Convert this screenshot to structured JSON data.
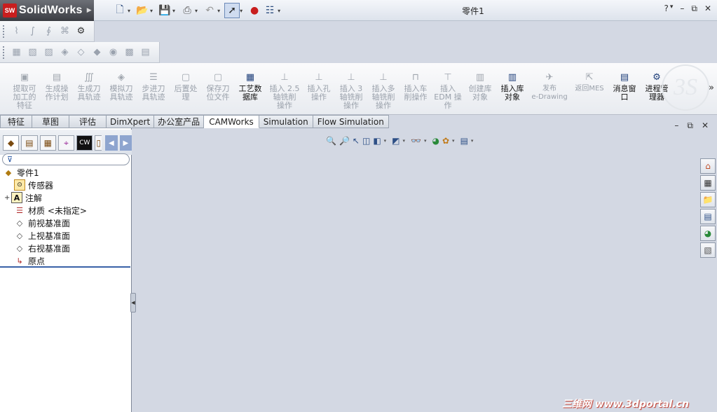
{
  "app": {
    "brand_badge": "SW",
    "name": "SolidWorks",
    "doc_title": "零件1"
  },
  "win_controls": {
    "help": "?",
    "help_dd": "▾",
    "minimize": "–",
    "restore": "⧉",
    "close": "✕"
  },
  "command_manager": [
    {
      "label": "提取可\n加工的\n特征",
      "active": false
    },
    {
      "label": "生成操\n作计划",
      "active": false
    },
    {
      "label": "生成刀\n具轨迹",
      "active": false
    },
    {
      "label": "模拟刀\n具轨迹",
      "active": false
    },
    {
      "label": "步进刀\n具轨迹",
      "active": false
    },
    {
      "label": "后置处\n理",
      "active": false
    },
    {
      "label": "保存刀\n位文件",
      "active": false
    },
    {
      "label": "工艺数\n据库",
      "active": true
    },
    {
      "label": "插入 2.5\n轴铣削\n操作",
      "active": false
    },
    {
      "label": "插入孔\n操作",
      "active": false
    },
    {
      "label": "插入 3\n轴铣削\n操作",
      "active": false
    },
    {
      "label": "插入多\n轴铣削\n操作",
      "active": false
    },
    {
      "label": "插入车\n削操作",
      "active": false
    },
    {
      "label": "插入\nEDM 操\n作",
      "active": false
    },
    {
      "label": "创建库\n对象",
      "active": false
    },
    {
      "label": "插入库\n对象",
      "active": true
    },
    {
      "label": "发布\ne-Drawing",
      "active": false
    },
    {
      "label": "返回MES",
      "active": false
    },
    {
      "label": "消息窗\n口",
      "active": true
    },
    {
      "label": "进程管\n理器",
      "active": true
    }
  ],
  "more_commands": "»",
  "tabs": [
    {
      "label": "特征",
      "active": false
    },
    {
      "label": "草图",
      "active": false
    },
    {
      "label": "评估",
      "active": false
    },
    {
      "label": "DimXpert",
      "active": false
    },
    {
      "label": "办公室产品",
      "active": false
    },
    {
      "label": "CAMWorks",
      "active": true
    },
    {
      "label": "Simulation",
      "active": false
    },
    {
      "label": "Flow Simulation",
      "active": false
    }
  ],
  "filter_icon": "⊽",
  "tree": [
    {
      "label": "零件1",
      "icon": "part-icon"
    },
    {
      "label": "传感器",
      "icon": "sensor-icon"
    },
    {
      "label": "注解",
      "icon": "annotation-icon",
      "expand": "+"
    },
    {
      "label": "材质 <未指定>",
      "icon": "material-icon"
    },
    {
      "label": "前视基准面",
      "icon": "plane-icon"
    },
    {
      "label": "上视基准面",
      "icon": "plane-icon"
    },
    {
      "label": "右视基准面",
      "icon": "plane-icon"
    },
    {
      "label": "原点",
      "icon": "origin-icon"
    }
  ],
  "watermark": "三维网 www.3dportal.cn",
  "colors": {
    "accent": "#3a62a8",
    "graphics_bg": "#d3d8e3",
    "brand_red": "#c81e1e"
  }
}
